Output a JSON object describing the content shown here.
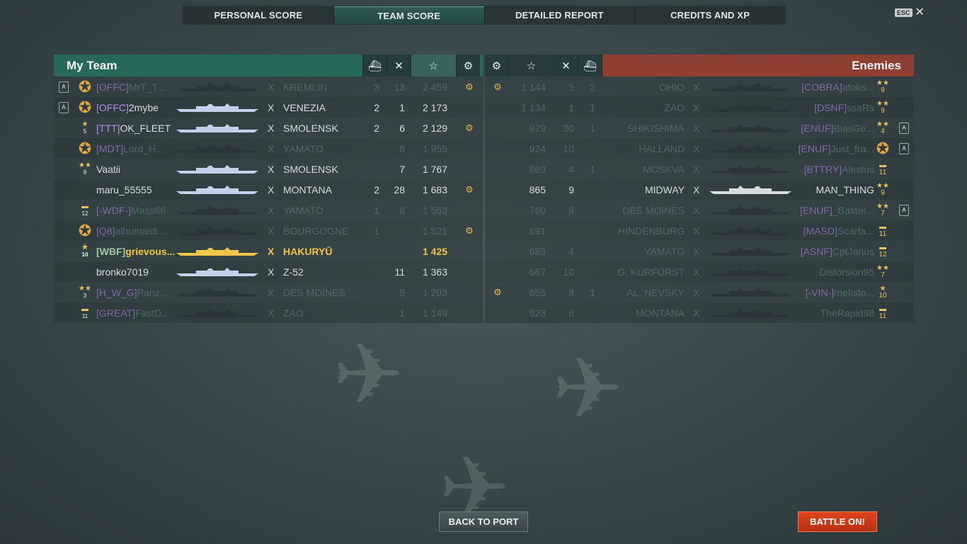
{
  "tabs": [
    "PERSONAL SCORE",
    "TEAM SCORE",
    "DETAILED REPORT",
    "CREDITS AND XP"
  ],
  "active_tab": 1,
  "esc_label": "ESC",
  "my_team_title": "My Team",
  "enemies_title": "Enemies",
  "buttons": {
    "back": "BACK TO PORT",
    "battle": "BATTLE ON!"
  },
  "colors": {
    "team_header": "#26685c",
    "enemy_header": "#8e3f31",
    "player_highlight": "#f2c649"
  },
  "my_team": [
    {
      "clan": "[OFFC]",
      "player": "MrT_T...",
      "ship": "KREMLIN",
      "planes": "3",
      "kills": "13",
      "score": "2 459",
      "ach": true,
      "dead": true,
      "rank_icon": true,
      "level_icon": "medal"
    },
    {
      "clan": "[OFFC]",
      "player": "2mybe",
      "ship": "VENEZIA",
      "planes": "2",
      "kills": "1",
      "score": "2 173",
      "ach": false,
      "dead": false,
      "rank_icon": true,
      "level_icon": "medal"
    },
    {
      "clan": "[TTT]",
      "player": "OK_FLEET",
      "ship": "SMOLENSK",
      "planes": "2",
      "kills": "6",
      "score": "2 129",
      "ach": true,
      "dead": false,
      "rank_icon": false,
      "level_icon": "star",
      "level_num": "5"
    },
    {
      "clan": "[MDT]",
      "player": "Lord_H...",
      "ship": "YAMATO",
      "planes": "",
      "kills": "8",
      "score": "1 955",
      "ach": false,
      "dead": true,
      "rank_icon": false,
      "level_icon": "medal",
      "clan_class": "c-green"
    },
    {
      "clan": "",
      "player": "Vaatii",
      "ship": "SMOLENSK",
      "planes": "",
      "kills": "7",
      "score": "1 767",
      "ach": false,
      "dead": false,
      "rank_icon": false,
      "level_icon": "stars2",
      "level_num": "9"
    },
    {
      "clan": "",
      "player": "maru_55555",
      "ship": "MONTANA",
      "planes": "2",
      "kills": "28",
      "score": "1 683",
      "ach": true,
      "dead": false,
      "rank_icon": false,
      "level_icon": ""
    },
    {
      "clan": "[-WDF-]",
      "player": "Mass66",
      "ship": "YAMATO",
      "planes": "1",
      "kills": "8",
      "score": "1 553",
      "ach": false,
      "dead": true,
      "rank_icon": false,
      "level_icon": "bar",
      "level_num": "12",
      "clan_class": "c-gray"
    },
    {
      "clan": "[Q8]",
      "player": "alhumaidi...",
      "ship": "BOURGOGNE",
      "planes": "1",
      "kills": "",
      "score": "1 521",
      "ach": true,
      "dead": true,
      "rank_icon": false,
      "level_icon": "medal",
      "clan_class": "c-gold"
    },
    {
      "clan": "[WBF]",
      "player": "grievous...",
      "ship": "HAKURYŪ",
      "planes": "",
      "kills": "",
      "score": "1 425",
      "ach": false,
      "dead": false,
      "mine": true,
      "rank_icon": false,
      "level_icon": "star",
      "level_num": "10",
      "clan_class": "c-green"
    },
    {
      "clan": "",
      "player": "bronko7019",
      "ship": "Z-52",
      "planes": "",
      "kills": "11",
      "score": "1 363",
      "ach": false,
      "dead": false,
      "rank_icon": false,
      "level_icon": ""
    },
    {
      "clan": "[H_W_G]",
      "player": "Panz...",
      "ship": "DES MOINES",
      "planes": "",
      "kills": "9",
      "score": "1 203",
      "ach": false,
      "dead": true,
      "rank_icon": false,
      "level_icon": "stars3",
      "level_num": "3",
      "clan_class": "c-gray"
    },
    {
      "clan": "[GREAT]",
      "player": "FastD...",
      "ship": "ZAO",
      "planes": "",
      "kills": "1",
      "score": "1 149",
      "ach": false,
      "dead": true,
      "rank_icon": false,
      "level_icon": "bar",
      "level_num": "11",
      "clan_class": "c-orange"
    }
  ],
  "enemies": [
    {
      "clan": "[COBRA]",
      "player": "atoks...",
      "ship": "OHIO",
      "planes": "2",
      "kills": "5",
      "score": "1 144",
      "ach": true,
      "dead": true,
      "rank_icon": false,
      "level_icon": "stars2",
      "level_num": "9",
      "clan_class": "c-gold"
    },
    {
      "clan": "[DSNF]",
      "player": "ssaRs",
      "ship": "ZAO",
      "planes": "1",
      "kills": "1",
      "score": "1 134",
      "ach": false,
      "dead": true,
      "rank_icon": false,
      "level_icon": "stars2",
      "level_num": "9",
      "clan_class": "c-gray"
    },
    {
      "clan": "[ENUF]",
      "player": "BiasGe...",
      "ship": "SHIKISHIMA",
      "planes": "1",
      "kills": "30",
      "score": "979",
      "ach": false,
      "dead": true,
      "rank_icon": true,
      "level_icon": "stars2",
      "level_num": "4"
    },
    {
      "clan": "[ENUF]",
      "player": "Just_fra...",
      "ship": "HALLAND",
      "planes": "",
      "kills": "10",
      "score": "924",
      "ach": false,
      "dead": true,
      "rank_icon": true,
      "level_icon": "medal"
    },
    {
      "clan": "[BTTRY]",
      "player": "Alestus",
      "ship": "MOSKVA",
      "planes": "1",
      "kills": "4",
      "score": "869",
      "ach": false,
      "dead": true,
      "rank_icon": false,
      "level_icon": "bar",
      "level_num": "11",
      "clan_class": "c-orange"
    },
    {
      "clan": "",
      "player": "MAN_THING",
      "ship": "MIDWAY",
      "planes": "",
      "kills": "9",
      "score": "865",
      "ach": false,
      "dead": false,
      "rank_icon": false,
      "level_icon": "stars2",
      "level_num": "9"
    },
    {
      "clan": "[ENUF]",
      "player": "_Baxter...",
      "ship": "DES MOINES",
      "planes": "",
      "kills": "9",
      "score": "760",
      "ach": false,
      "dead": true,
      "rank_icon": true,
      "level_icon": "stars3",
      "level_num": "7"
    },
    {
      "clan": "[MASD]",
      "player": "Scarfa...",
      "ship": "HINDENBURG",
      "planes": "",
      "kills": "",
      "score": "691",
      "ach": false,
      "dead": true,
      "rank_icon": false,
      "level_icon": "bar",
      "level_num": "11",
      "clan_class": "c-gold"
    },
    {
      "clan": "[ASNF]",
      "player": "CptJanus",
      "ship": "YAMATO",
      "planes": "",
      "kills": "4",
      "score": "683",
      "ach": false,
      "dead": true,
      "rank_icon": false,
      "level_icon": "bar",
      "level_num": "12",
      "clan_class": "c-orange"
    },
    {
      "clan": "",
      "player": "Distorsion95",
      "ship": "G. KURFÜRST",
      "planes": "",
      "kills": "10",
      "score": "667",
      "ach": false,
      "dead": true,
      "rank_icon": false,
      "level_icon": "stars3",
      "level_num": "7"
    },
    {
      "clan": "[-VIN-]",
      "player": "mefisto...",
      "ship": "AL. NEVSKY",
      "planes": "1",
      "kills": "8",
      "score": "655",
      "ach": true,
      "dead": true,
      "rank_icon": false,
      "level_icon": "star",
      "level_num": "10",
      "clan_class": "c-gray"
    },
    {
      "clan": "",
      "player": "TheRapid98",
      "ship": "MONTANA",
      "planes": "",
      "kills": "6",
      "score": "523",
      "ach": false,
      "dead": true,
      "rank_icon": false,
      "level_icon": "bar",
      "level_num": "11"
    }
  ]
}
